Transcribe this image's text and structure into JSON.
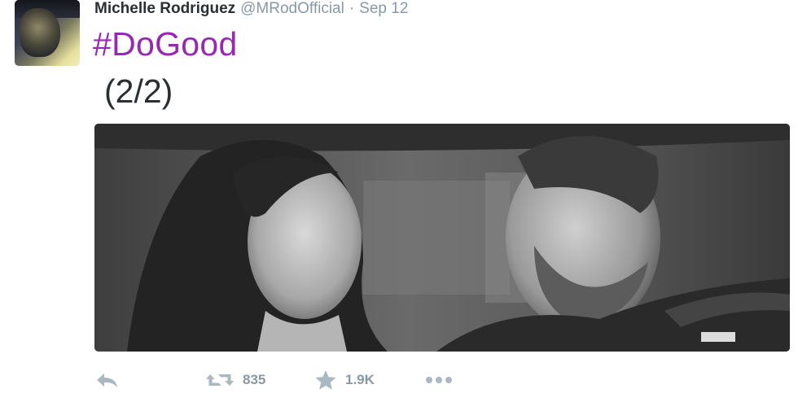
{
  "tweet": {
    "fullname": "Michelle Rodriguez",
    "username": "@MRodOfficial",
    "separator": "·",
    "time": "Sep 12",
    "hashtag": "#DoGood",
    "text": "(2/2)",
    "actions": {
      "reply_icon": "reply-icon",
      "retweet_icon": "retweet-icon",
      "retweet_count": "835",
      "favorite_icon": "star-icon",
      "favorite_count": "1.9K",
      "more_icon": "more-icon"
    },
    "colors": {
      "hashtag": "#9628b4",
      "name": "#292f33",
      "meta": "#8899a6",
      "action_icon": "#aab8c2"
    }
  }
}
